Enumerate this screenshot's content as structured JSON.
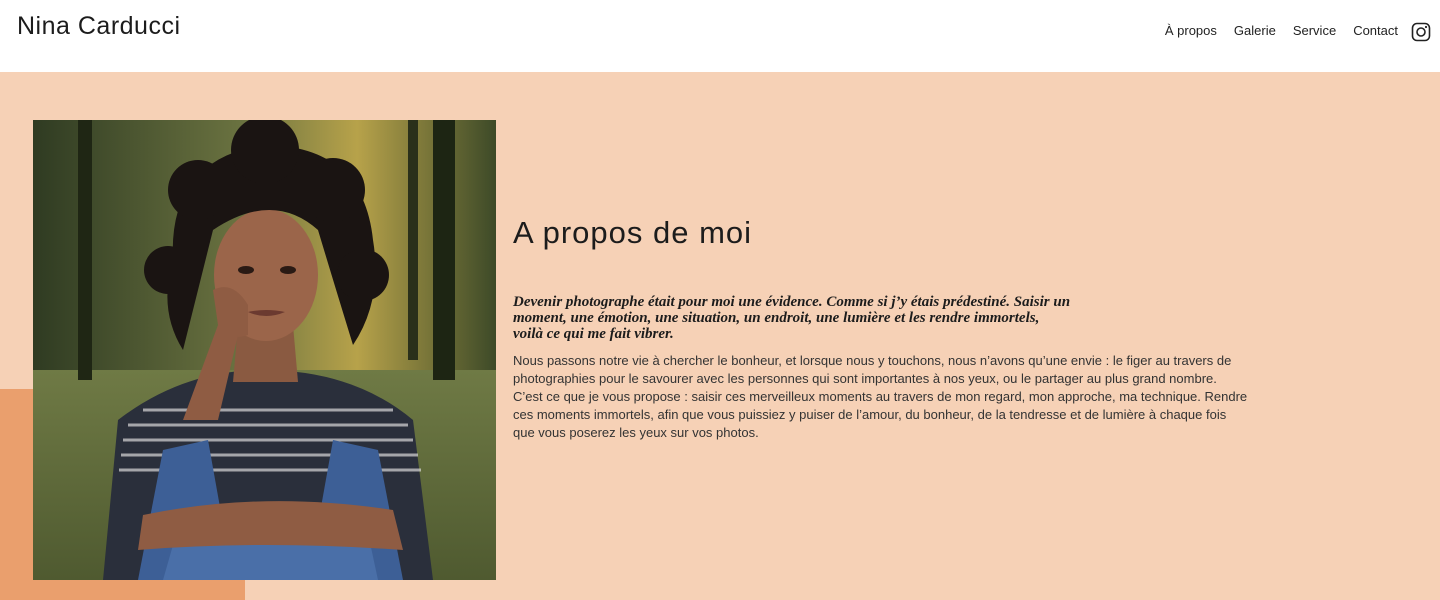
{
  "header": {
    "brand": "Nina Carducci",
    "nav": {
      "about": "À propos",
      "gallery": "Galerie",
      "service": "Service",
      "contact": "Contact"
    }
  },
  "about": {
    "title": "A propos de moi",
    "lead": "Devenir photographe était pour moi une évidence. Comme si j’y étais prédestiné. Saisir un moment, une émotion, une situation, un endroit, une lumière et les rendre immortels, voilà ce qui me fait vibrer.",
    "body": "Nous passons notre vie à chercher le bonheur, et lorsque nous y touchons, nous n’avons qu’une envie : le figer au travers de photographies pour le savourer avec les personnes qui sont importantes à nos yeux, ou le partager au plus grand nombre. C’est ce que je vous propose : saisir ces merveilleux moments au travers de mon regard, mon approche, ma technique. Rendre ces moments immortels, afin que vous puissiez y puiser de l’amour, du bonheur, de la tendresse et de lumière à chaque fois que vous poserez les yeux sur vos photos."
  },
  "colors": {
    "background_main": "#f6d1b6",
    "accent_block": "#ea9f6d",
    "header_bg": "#ffffff"
  },
  "icons": {
    "social": "instagram-icon"
  }
}
